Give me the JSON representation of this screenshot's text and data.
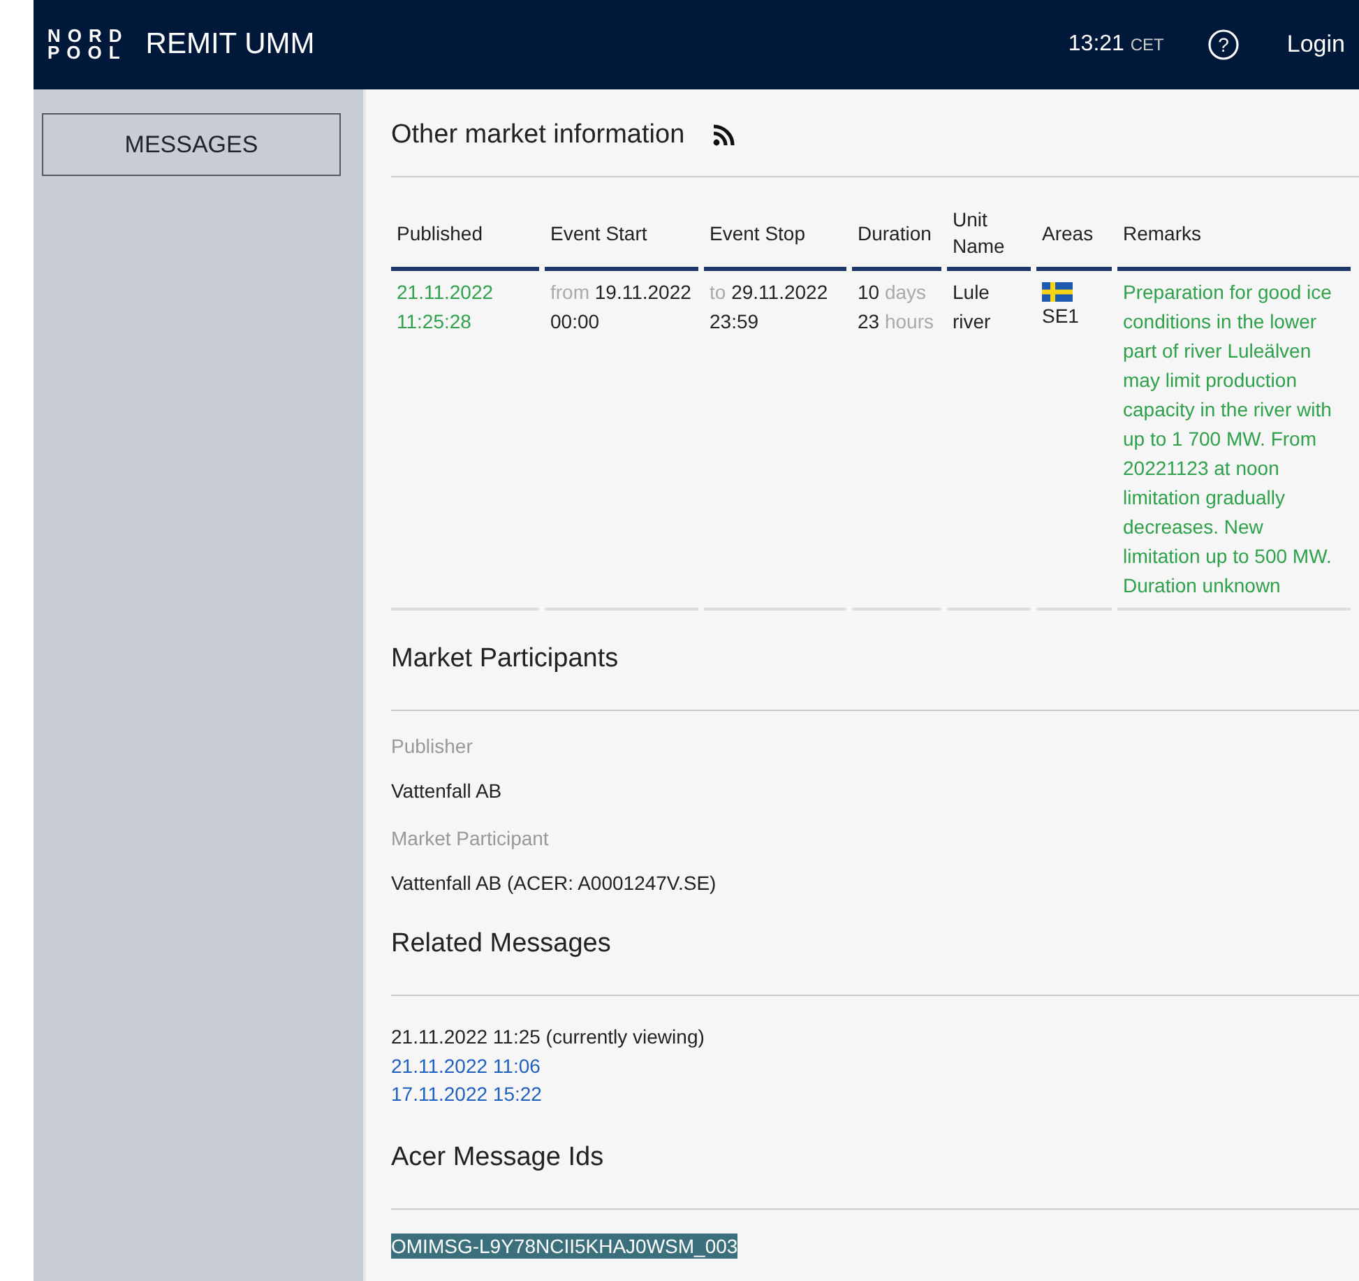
{
  "header": {
    "logo_top": "NORD",
    "logo_bottom": "POOL",
    "title": "REMIT UMM",
    "time": "13:21",
    "timezone": "CET",
    "help": "?",
    "login": "Login"
  },
  "sidebar": {
    "items": [
      {
        "label": "MESSAGES",
        "selected": false
      }
    ]
  },
  "main": {
    "title": "Other market information",
    "table": {
      "columns": [
        "Published",
        "Event Start",
        "Event Stop",
        "Duration",
        "Unit Name",
        "Areas",
        "Remarks"
      ],
      "rows": [
        {
          "cells": [
            {
              "kind": "text",
              "parts": [
                {
                  "text": "21.11.2022 11:25:28",
                  "kind": "green"
                }
              ]
            },
            {
              "kind": "text",
              "parts": [
                {
                  "text": "from",
                  "kind": "muted"
                },
                {
                  "text": "19.11.2022 00:00",
                  "kind": "plain"
                }
              ]
            },
            {
              "kind": "text",
              "parts": [
                {
                  "text": "to",
                  "kind": "muted"
                },
                {
                  "text": "29.11.2022 23:59",
                  "kind": "plain"
                }
              ]
            },
            {
              "kind": "text",
              "parts": [
                {
                  "text": "10",
                  "kind": "plain"
                },
                {
                  "text": "days",
                  "kind": "muted"
                },
                {
                  "text": "23",
                  "kind": "plain"
                },
                {
                  "text": "hours",
                  "kind": "muted"
                }
              ]
            },
            {
              "kind": "text",
              "parts": [
                {
                  "text": "Lule river",
                  "kind": "plain"
                }
              ]
            },
            {
              "kind": "area",
              "parts": [
                {
                  "text": "SE1",
                  "kind": "plain"
                }
              ]
            },
            {
              "kind": "text",
              "parts": [
                {
                  "text": "Preparation for good ice conditions in the lower part of river Luleälven may limit production capacity in the river with up to 1 700 MW. From 20221123 at noon limitation gradually decreases. New limitation up to 500 MW. Duration unknown",
                  "kind": "green"
                }
              ]
            }
          ]
        }
      ]
    }
  },
  "market_participants": {
    "title": "Market Participants",
    "fields": [
      {
        "label": "Publisher",
        "value": "Vattenfall AB"
      },
      {
        "label": "Market Participant",
        "value": "Vattenfall AB (ACER: A0001247V.SE)"
      }
    ]
  },
  "related_messages": {
    "title": "Related Messages",
    "items": [
      {
        "text": "21.11.2022 11:25 (currently viewing)",
        "current": true
      },
      {
        "text": "21.11.2022 11:06",
        "current": false
      },
      {
        "text": "17.11.2022 15:22",
        "current": false
      }
    ]
  },
  "acer_message_ids": {
    "title": "Acer Message Ids",
    "items": [
      {
        "text": "OMIMSG-L9Y78NCII5KHAJ0WSM_003",
        "selected": true
      }
    ]
  }
}
